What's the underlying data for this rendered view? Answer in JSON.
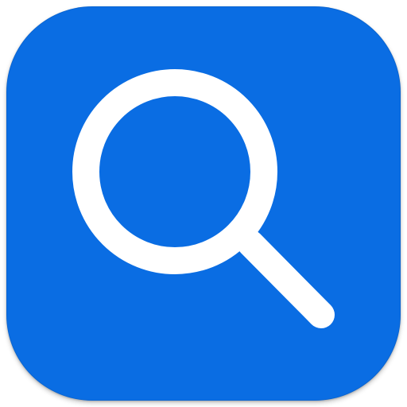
{
  "app_icon": {
    "icon": "search-icon",
    "colors": {
      "tile_background": "#0a6de3",
      "glyph": "#ffffff"
    }
  }
}
